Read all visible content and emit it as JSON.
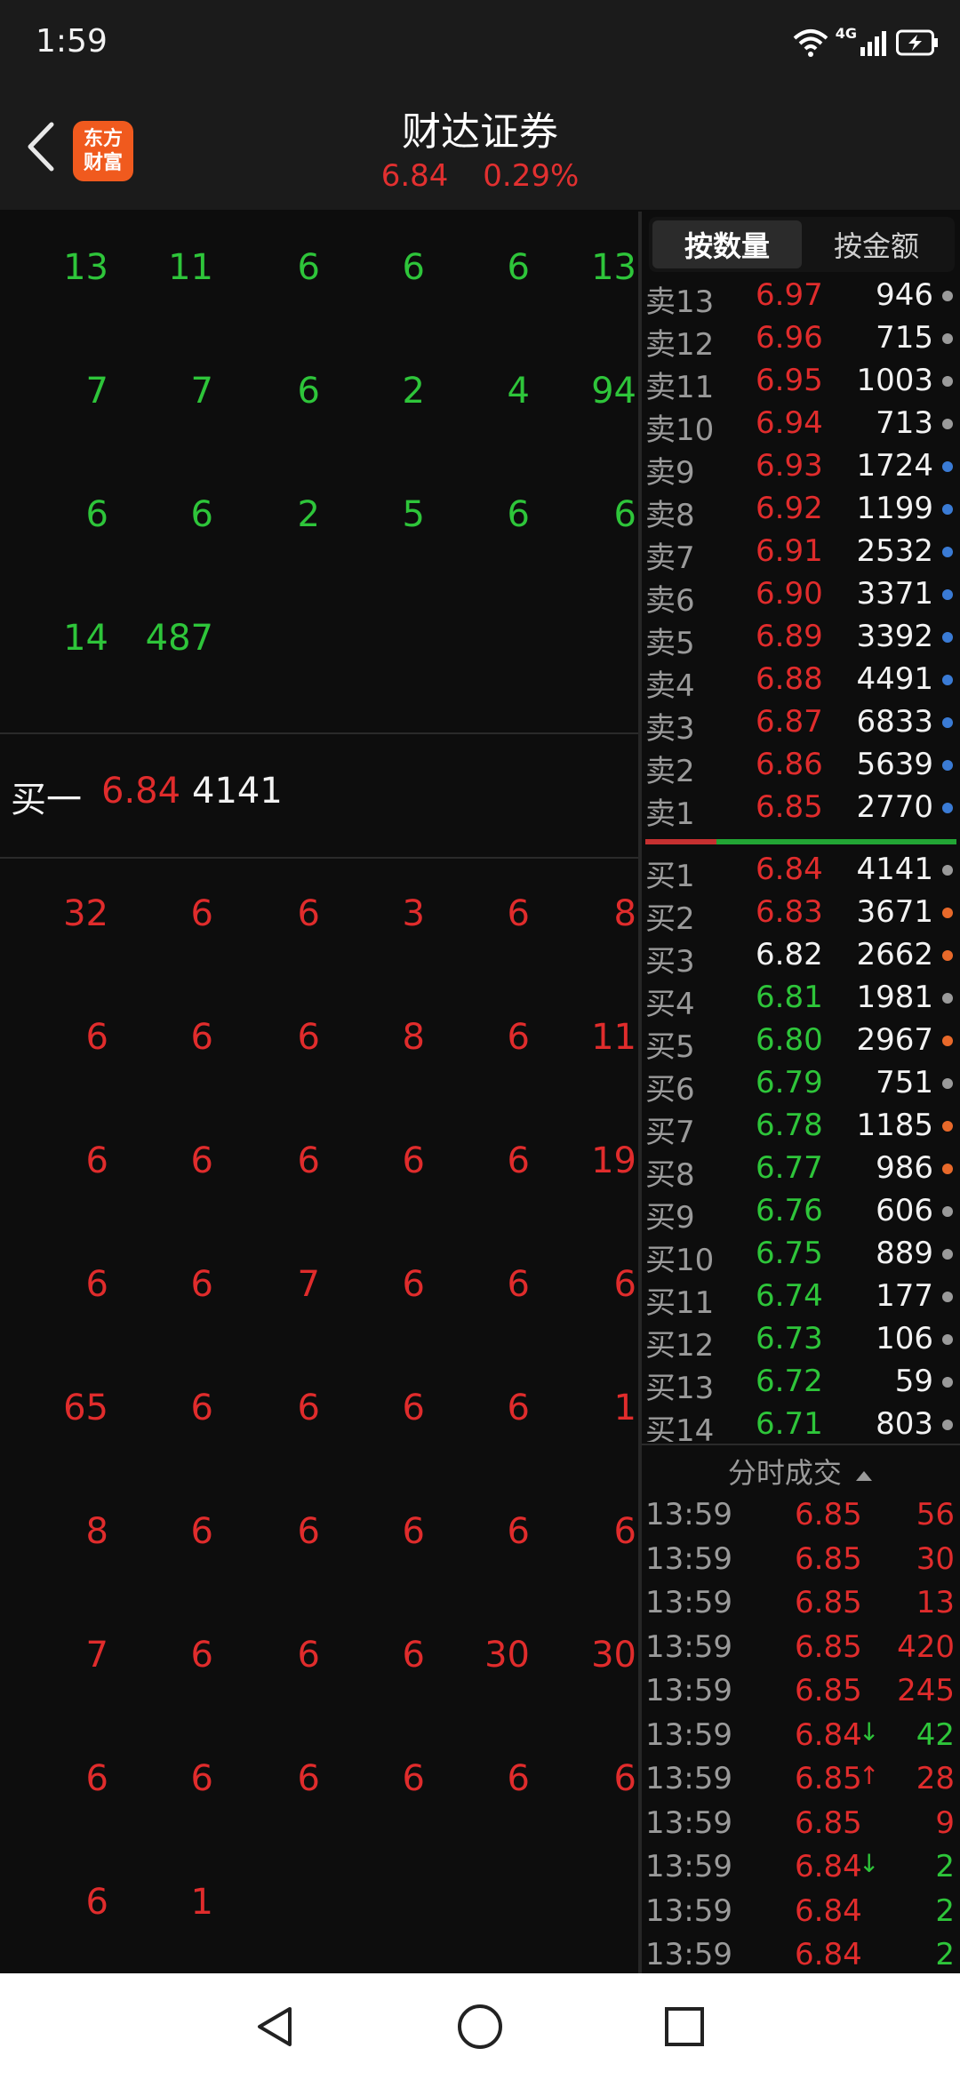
{
  "status_bar": {
    "time": "1:59",
    "network_label": "4G",
    "icons": [
      "wifi-icon",
      "signal-icon",
      "battery-charging-icon"
    ]
  },
  "header": {
    "title": "财达证券",
    "price": "6.84",
    "change_pct": "0.29%",
    "logo_line1": "东方",
    "logo_line2": "财富",
    "logo_color": "#f05a1e"
  },
  "queue": {
    "sell_rows": [
      [
        "13",
        "11",
        "6",
        "6",
        "6",
        "13"
      ],
      [
        "7",
        "7",
        "6",
        "2",
        "4",
        "94"
      ],
      [
        "6",
        "6",
        "2",
        "5",
        "6",
        "6"
      ],
      [
        "14",
        "487",
        "",
        "",
        "",
        ""
      ]
    ],
    "buy1": {
      "label": "买一",
      "price": "6.84",
      "volume": "4141"
    },
    "buy_rows": [
      [
        "32",
        "6",
        "6",
        "3",
        "6",
        "8"
      ],
      [
        "6",
        "6",
        "6",
        "8",
        "6",
        "11"
      ],
      [
        "6",
        "6",
        "6",
        "6",
        "6",
        "19"
      ],
      [
        "6",
        "6",
        "7",
        "6",
        "6",
        "6"
      ],
      [
        "65",
        "6",
        "6",
        "6",
        "6",
        "1"
      ],
      [
        "8",
        "6",
        "6",
        "6",
        "6",
        "6"
      ],
      [
        "7",
        "6",
        "6",
        "6",
        "30",
        "30"
      ],
      [
        "6",
        "6",
        "6",
        "6",
        "6",
        "6"
      ],
      [
        "6",
        "1",
        "",
        "",
        "",
        ""
      ]
    ]
  },
  "tabs": {
    "by_volume": "按数量",
    "by_amount": "按金额"
  },
  "order_book": {
    "sells": [
      {
        "label": "卖13",
        "price": "6.97",
        "volume": "946",
        "dot": "#9a9a9a"
      },
      {
        "label": "卖12",
        "price": "6.96",
        "volume": "715",
        "dot": "#9a9a9a"
      },
      {
        "label": "卖11",
        "price": "6.95",
        "volume": "1003",
        "dot": "#9a9a9a"
      },
      {
        "label": "卖10",
        "price": "6.94",
        "volume": "713",
        "dot": "#9a9a9a"
      },
      {
        "label": "卖9",
        "price": "6.93",
        "volume": "1724",
        "dot": "#3a7bd5"
      },
      {
        "label": "卖8",
        "price": "6.92",
        "volume": "1199",
        "dot": "#3a7bd5"
      },
      {
        "label": "卖7",
        "price": "6.91",
        "volume": "2532",
        "dot": "#3a7bd5"
      },
      {
        "label": "卖6",
        "price": "6.90",
        "volume": "3371",
        "dot": "#3a7bd5"
      },
      {
        "label": "卖5",
        "price": "6.89",
        "volume": "3392",
        "dot": "#3a7bd5"
      },
      {
        "label": "卖4",
        "price": "6.88",
        "volume": "4491",
        "dot": "#3a7bd5"
      },
      {
        "label": "卖3",
        "price": "6.87",
        "volume": "6833",
        "dot": "#3a7bd5"
      },
      {
        "label": "卖2",
        "price": "6.86",
        "volume": "5639",
        "dot": "#3a7bd5"
      },
      {
        "label": "卖1",
        "price": "6.85",
        "volume": "2770",
        "dot": "#3a7bd5"
      }
    ],
    "buys": [
      {
        "label": "买1",
        "price": "6.84",
        "volume": "4141",
        "color": "#e02c2c",
        "dot": "#9a9a9a"
      },
      {
        "label": "买2",
        "price": "6.83",
        "volume": "3671",
        "color": "#e02c2c",
        "dot": "#e8692a"
      },
      {
        "label": "买3",
        "price": "6.82",
        "volume": "2662",
        "color": "#f2f2f2",
        "dot": "#e8692a"
      },
      {
        "label": "买4",
        "price": "6.81",
        "volume": "1981",
        "color": "#2ec53a",
        "dot": "#9a9a9a"
      },
      {
        "label": "买5",
        "price": "6.80",
        "volume": "2967",
        "color": "#2ec53a",
        "dot": "#e8692a"
      },
      {
        "label": "买6",
        "price": "6.79",
        "volume": "751",
        "color": "#2ec53a",
        "dot": "#9a9a9a"
      },
      {
        "label": "买7",
        "price": "6.78",
        "volume": "1185",
        "color": "#2ec53a",
        "dot": "#e8692a"
      },
      {
        "label": "买8",
        "price": "6.77",
        "volume": "986",
        "color": "#2ec53a",
        "dot": "#e8692a"
      },
      {
        "label": "买9",
        "price": "6.76",
        "volume": "606",
        "color": "#2ec53a",
        "dot": "#9a9a9a"
      },
      {
        "label": "买10",
        "price": "6.75",
        "volume": "889",
        "color": "#2ec53a",
        "dot": "#9a9a9a"
      },
      {
        "label": "买11",
        "price": "6.74",
        "volume": "177",
        "color": "#2ec53a",
        "dot": "#9a9a9a"
      },
      {
        "label": "买12",
        "price": "6.73",
        "volume": "106",
        "color": "#2ec53a",
        "dot": "#9a9a9a"
      },
      {
        "label": "买13",
        "price": "6.72",
        "volume": "59",
        "color": "#2ec53a",
        "dot": "#9a9a9a"
      },
      {
        "label": "买14",
        "price": "6.71",
        "volume": "803",
        "color": "#2ec53a",
        "dot": "#9a9a9a"
      }
    ]
  },
  "trades": {
    "header": "分时成交",
    "rows": [
      {
        "time": "13:59",
        "price": "6.85",
        "arrow": "",
        "volume": "56",
        "vcolor": "#e02c2c"
      },
      {
        "time": "13:59",
        "price": "6.85",
        "arrow": "",
        "volume": "30",
        "vcolor": "#e02c2c"
      },
      {
        "time": "13:59",
        "price": "6.85",
        "arrow": "",
        "volume": "13",
        "vcolor": "#e02c2c"
      },
      {
        "time": "13:59",
        "price": "6.85",
        "arrow": "",
        "volume": "420",
        "vcolor": "#e02c2c"
      },
      {
        "time": "13:59",
        "price": "6.85",
        "arrow": "",
        "volume": "245",
        "vcolor": "#e02c2c"
      },
      {
        "time": "13:59",
        "price": "6.84",
        "arrow": "↓",
        "volume": "42",
        "vcolor": "#2ec53a"
      },
      {
        "time": "13:59",
        "price": "6.85",
        "arrow": "↑",
        "volume": "28",
        "vcolor": "#e02c2c"
      },
      {
        "time": "13:59",
        "price": "6.85",
        "arrow": "",
        "volume": "9",
        "vcolor": "#e02c2c"
      },
      {
        "time": "13:59",
        "price": "6.84",
        "arrow": "↓",
        "volume": "2",
        "vcolor": "#2ec53a"
      },
      {
        "time": "13:59",
        "price": "6.84",
        "arrow": "",
        "volume": "2",
        "vcolor": "#2ec53a"
      },
      {
        "time": "13:59",
        "price": "6.84",
        "arrow": "",
        "volume": "2",
        "vcolor": "#2ec53a"
      }
    ]
  },
  "nav": {
    "icons": [
      "back-triangle-icon",
      "home-circle-icon",
      "recents-square-icon"
    ]
  }
}
